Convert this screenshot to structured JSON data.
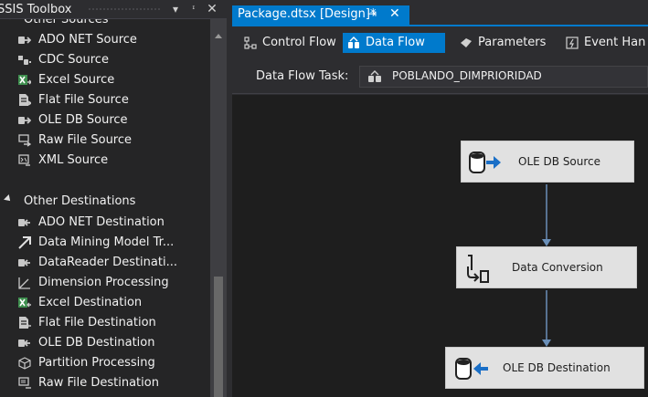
{
  "toolbox": {
    "title": "SSIS Toolbox",
    "categories": [
      {
        "label": "Other Sources",
        "items": [
          {
            "label": "ADO NET Source",
            "icon": "ado-net-source-icon"
          },
          {
            "label": "CDC Source",
            "icon": "cdc-source-icon"
          },
          {
            "label": "Excel Source",
            "icon": "excel-source-icon"
          },
          {
            "label": "Flat File Source",
            "icon": "flat-file-source-icon"
          },
          {
            "label": "OLE DB Source",
            "icon": "ole-db-source-icon"
          },
          {
            "label": "Raw File Source",
            "icon": "raw-file-source-icon"
          },
          {
            "label": "XML Source",
            "icon": "xml-source-icon"
          }
        ]
      },
      {
        "label": "Other Destinations",
        "items": [
          {
            "label": "ADO NET Destination",
            "icon": "ado-net-destination-icon"
          },
          {
            "label": "Data Mining Model Tr...",
            "icon": "data-mining-icon"
          },
          {
            "label": "DataReader Destinati...",
            "icon": "datareader-destination-icon"
          },
          {
            "label": "Dimension Processing",
            "icon": "dimension-processing-icon"
          },
          {
            "label": "Excel Destination",
            "icon": "excel-destination-icon"
          },
          {
            "label": "Flat File Destination",
            "icon": "flat-file-destination-icon"
          },
          {
            "label": "OLE DB Destination",
            "icon": "ole-db-destination-icon"
          },
          {
            "label": "Partition Processing",
            "icon": "partition-processing-icon"
          },
          {
            "label": "Raw File Destination",
            "icon": "raw-file-destination-icon"
          }
        ]
      }
    ]
  },
  "document": {
    "tab_title": "Package.dtsx [Design]*",
    "designer_tabs": [
      {
        "label": "Control Flow",
        "active": false
      },
      {
        "label": "Data Flow",
        "active": true
      },
      {
        "label": "Parameters",
        "active": false
      },
      {
        "label": "Event Han",
        "active": false
      }
    ],
    "task_label": "Data Flow Task:",
    "task_value": "POBLANDO_DIMPRIORIDAD"
  },
  "canvas": {
    "nodes": [
      {
        "label": "OLE DB Source",
        "icon": "ole-db-source-icon"
      },
      {
        "label": "Data Conversion",
        "icon": "data-conversion-icon"
      },
      {
        "label": "OLE DB Destination",
        "icon": "ole-db-destination-icon"
      }
    ]
  },
  "colors": {
    "accent": "#007acc",
    "panel_bg": "#252526",
    "canvas_bg": "#1e1e1e",
    "node_bg": "#e1e1e1",
    "connector": "#6a8fb8"
  }
}
